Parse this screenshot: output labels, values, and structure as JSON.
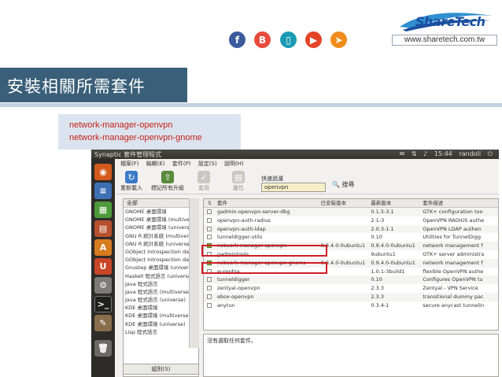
{
  "brand": {
    "name": "ShareTech",
    "website": "www.sharetech.com.tw"
  },
  "social": [
    {
      "icon": "facebook-icon",
      "glyph": "f"
    },
    {
      "icon": "blog-icon",
      "glyph": "B"
    },
    {
      "icon": "phone-icon",
      "glyph": "▯"
    },
    {
      "icon": "youtube-icon",
      "glyph": "▶"
    },
    {
      "icon": "share-icon",
      "glyph": "➤"
    }
  ],
  "slide": {
    "title": "安裝相關所需套件",
    "packages": [
      "network-manager-openvpn",
      "network-manager-openvpn-gnome"
    ]
  },
  "window": {
    "title": "Synaptic 套件管理程式",
    "tray": {
      "time": "15:44",
      "user": "randoll"
    },
    "menu": [
      "檔案(F)",
      "編輯(E)",
      "套件(P)",
      "設定(S)",
      "說明(H)"
    ],
    "toolbar": {
      "reload": "重新載入",
      "mark_all": "標記所有升級",
      "apply": "套用",
      "properties": "屬性",
      "quick_filter_label": "快速過濾",
      "quick_filter_value": "openvpn",
      "search": "搜尋"
    },
    "sidebar": {
      "header": "全部",
      "items": [
        "GNOME 桌面環境",
        "GNOME 桌面環境 (multiver",
        "GNOME 桌面環境 (universe",
        "GNU R 統計系統 (multivers",
        "GNU R 統計系統 (universe)",
        "GObject Introspection data",
        "GObject Introspection data",
        "Gnustep 桌面環境 (universe",
        "Haskell 程式語言 (universe)",
        "Java 程式語言",
        "Java 程式語言 (multiverse)",
        "Java 程式語言 (universe)",
        "KDE 桌面環境",
        "KDE 桌面環境 (multiverse)",
        "KDE 桌面環境 (universe)",
        "Lisp 程式語言"
      ],
      "group_button": "組別(S)"
    },
    "table": {
      "columns": [
        "S",
        "套件",
        "已安裝版本",
        "最新版本",
        "套件描述"
      ],
      "rows": [
        {
          "checked": false,
          "package": "gadmin-openvpn-server-dbg",
          "installed": "",
          "latest": "0.1.5-3.1",
          "desc": "GTK+ configuration too"
        },
        {
          "checked": false,
          "package": "openvpn-auth-radius",
          "installed": "",
          "latest": "2.1-3",
          "desc": "OpenVPN RADIUS authe"
        },
        {
          "checked": false,
          "package": "openvpn-auth-ldap",
          "installed": "",
          "latest": "2.0.3-1.1",
          "desc": "OpenVPN LDAP authen"
        },
        {
          "checked": false,
          "package": "tunneldigger-utils",
          "installed": "",
          "latest": "0.10",
          "desc": "Utilities for TunnelDigg"
        },
        {
          "checked": true,
          "package": "network-manager-openvpn",
          "installed": "0.9.4.0-0ubuntu1",
          "latest": "0.9.4.0-0ubuntu1",
          "desc": "network management f"
        },
        {
          "checked": false,
          "package": "gadmintools",
          "installed": "",
          "latest": "9ubuntu1",
          "desc": "GTK+ server administra"
        },
        {
          "checked": true,
          "package": "network-manager-openvpn-gnome",
          "installed": "0.9.4.0-0ubuntu1",
          "latest": "0.9.4.0-0ubuntu1",
          "desc": "network management f"
        },
        {
          "checked": false,
          "package": "eurephia",
          "installed": "",
          "latest": "1.0.1-3build1",
          "desc": "flexible OpenVPN authe"
        },
        {
          "checked": false,
          "package": "tunneldigger",
          "installed": "",
          "latest": "0.10",
          "desc": "Configures OpenVPN tu"
        },
        {
          "checked": false,
          "package": "zentyal-openvpn",
          "installed": "",
          "latest": "2.3.3",
          "desc": "Zentyal - VPN Service"
        },
        {
          "checked": false,
          "package": "ebox-openvpn",
          "installed": "",
          "latest": "2.3.3",
          "desc": "transitional dummy pac"
        },
        {
          "checked": false,
          "package": "anytun",
          "installed": "",
          "latest": "0.3.4-1",
          "desc": "secure anycast tunnelin"
        }
      ]
    },
    "description_text": "沒有選取任何套件。"
  }
}
